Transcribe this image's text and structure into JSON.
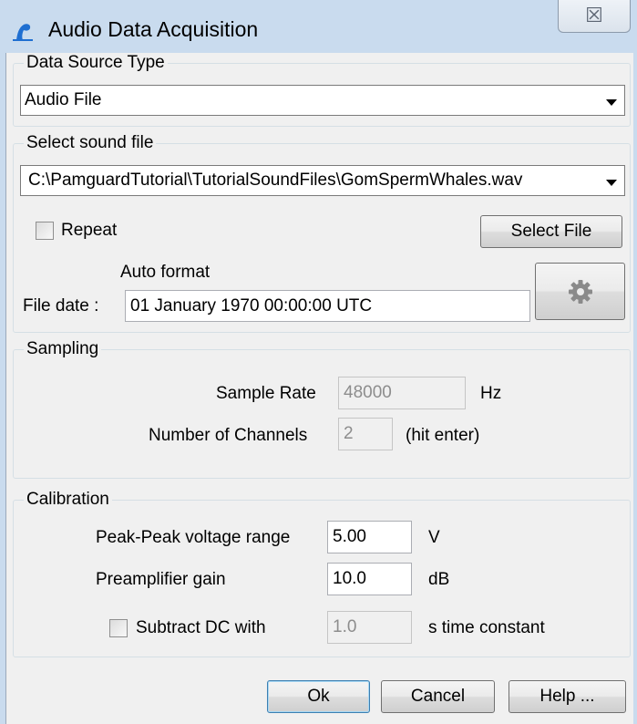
{
  "window": {
    "title": "Audio Data Acquisition",
    "icon": "pamguard-logo-icon",
    "close_glyph": "☒"
  },
  "data_source": {
    "legend": "Data Source Type",
    "selected": "Audio File"
  },
  "sound_file": {
    "legend": "Select sound file",
    "path": "C:\\PamguardTutorial\\TutorialSoundFiles\\GomSpermWhales.wav",
    "repeat_label": "Repeat",
    "repeat_checked": false,
    "select_file_label": "Select File",
    "auto_format_label": "Auto format",
    "file_date_label": "File date :",
    "file_date_value": "01 January 1970 00:00:00 UTC",
    "settings_icon": "gear-icon"
  },
  "sampling": {
    "legend": "Sampling",
    "sample_rate_label": "Sample Rate",
    "sample_rate_value": "48000",
    "sample_rate_unit": "Hz",
    "channels_label": "Number of Channels",
    "channels_value": "2",
    "channels_hint": "(hit enter)"
  },
  "calibration": {
    "legend": "Calibration",
    "voltage_label": "Peak-Peak voltage range",
    "voltage_value": "5.00",
    "voltage_unit": "V",
    "gain_label": "Preamplifier gain",
    "gain_value": "10.0",
    "gain_unit": "dB",
    "dc_label": "Subtract DC with",
    "dc_checked": false,
    "dc_value": "1.0",
    "dc_unit": "s time constant"
  },
  "buttons": {
    "ok": "Ok",
    "cancel": "Cancel",
    "help": "Help ..."
  },
  "colors": {
    "title_bar": "#c9dbee",
    "dialog_bg": "#f0f0f0",
    "default_button_border": "#3c7fb1"
  }
}
